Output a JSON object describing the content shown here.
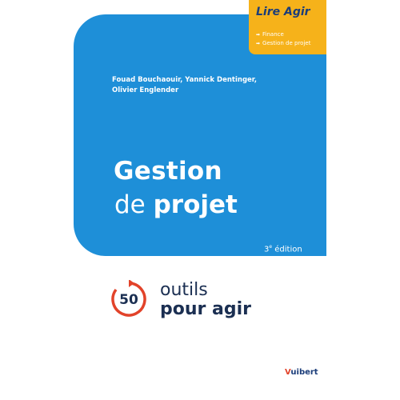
{
  "series": {
    "name": "Lire Agir",
    "subjects": [
      "Finance",
      "Gestion de projet"
    ]
  },
  "authors": [
    "Fouad Bouchaouir, Yannick Dentinger,",
    "Olivier Englender"
  ],
  "title": {
    "line1": "Gestion",
    "line2_light": "de",
    "line2_bold": "projet"
  },
  "edition": {
    "number": "3",
    "suffix": "e",
    "label": " édition"
  },
  "tagline": {
    "count": "50",
    "line1": "outils",
    "line2": "pour agir"
  },
  "publisher": {
    "initial": "V",
    "rest": "uibert"
  },
  "colors": {
    "blue": "#1e8fd8",
    "orange": "#f6b21a",
    "navy": "#1b2f52",
    "red": "#e2432a"
  }
}
